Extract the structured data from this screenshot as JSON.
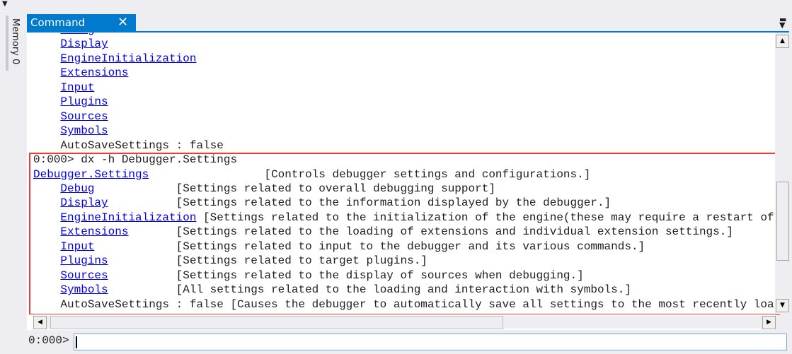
{
  "side_panel": {
    "memory_tab": "Memory 0"
  },
  "tab": {
    "label": "Command",
    "close": "✕"
  },
  "output_lines": [
    [
      {
        "t": "    "
      },
      {
        "l": "Debug"
      }
    ],
    [
      {
        "t": "    "
      },
      {
        "l": "Display"
      }
    ],
    [
      {
        "t": "    "
      },
      {
        "l": "EngineInitialization"
      }
    ],
    [
      {
        "t": "    "
      },
      {
        "l": "Extensions"
      }
    ],
    [
      {
        "t": "    "
      },
      {
        "l": "Input"
      }
    ],
    [
      {
        "t": "    "
      },
      {
        "l": "Plugins"
      }
    ],
    [
      {
        "t": "    "
      },
      {
        "l": "Sources"
      }
    ],
    [
      {
        "t": "    "
      },
      {
        "l": "Symbols"
      }
    ],
    [
      {
        "t": "    AutoSaveSettings : false"
      }
    ],
    [
      {
        "t": "0:000> dx -h Debugger.Settings"
      }
    ],
    [
      {
        "l": "Debugger.Settings"
      },
      {
        "t": "                 [Controls debugger settings and configurations.]"
      }
    ],
    [
      {
        "t": "    "
      },
      {
        "l": "Debug"
      },
      {
        "t": "            [Settings related to overall debugging support]"
      }
    ],
    [
      {
        "t": "    "
      },
      {
        "l": "Display"
      },
      {
        "t": "          [Settings related to the information displayed by the debugger.]"
      }
    ],
    [
      {
        "t": "    "
      },
      {
        "l": "EngineInitialization"
      },
      {
        "t": " [Settings related to the initialization of the engine(these may require a restart of"
      }
    ],
    [
      {
        "t": "    "
      },
      {
        "l": "Extensions"
      },
      {
        "t": "       [Settings related to the loading of extensions and individual extension settings.]"
      }
    ],
    [
      {
        "t": "    "
      },
      {
        "l": "Input"
      },
      {
        "t": "            [Settings related to input to the debugger and its various commands.]"
      }
    ],
    [
      {
        "t": "    "
      },
      {
        "l": "Plugins"
      },
      {
        "t": "          [Settings related to target plugins.]"
      }
    ],
    [
      {
        "t": "    "
      },
      {
        "l": "Sources"
      },
      {
        "t": "          [Settings related to the display of sources when debugging.]"
      }
    ],
    [
      {
        "t": "    "
      },
      {
        "l": "Symbols"
      },
      {
        "t": "          [All settings related to the loading and interaction with symbols.]"
      }
    ],
    [
      {
        "t": "    AutoSaveSettings : false [Causes the debugger to automatically save all settings to the most recently loa"
      }
    ]
  ],
  "command_input": {
    "prompt": "0:000>",
    "value": ""
  },
  "colors": {
    "accent": "#007acc",
    "link": "#0000ee",
    "highlight_box": "#f03a3a"
  }
}
